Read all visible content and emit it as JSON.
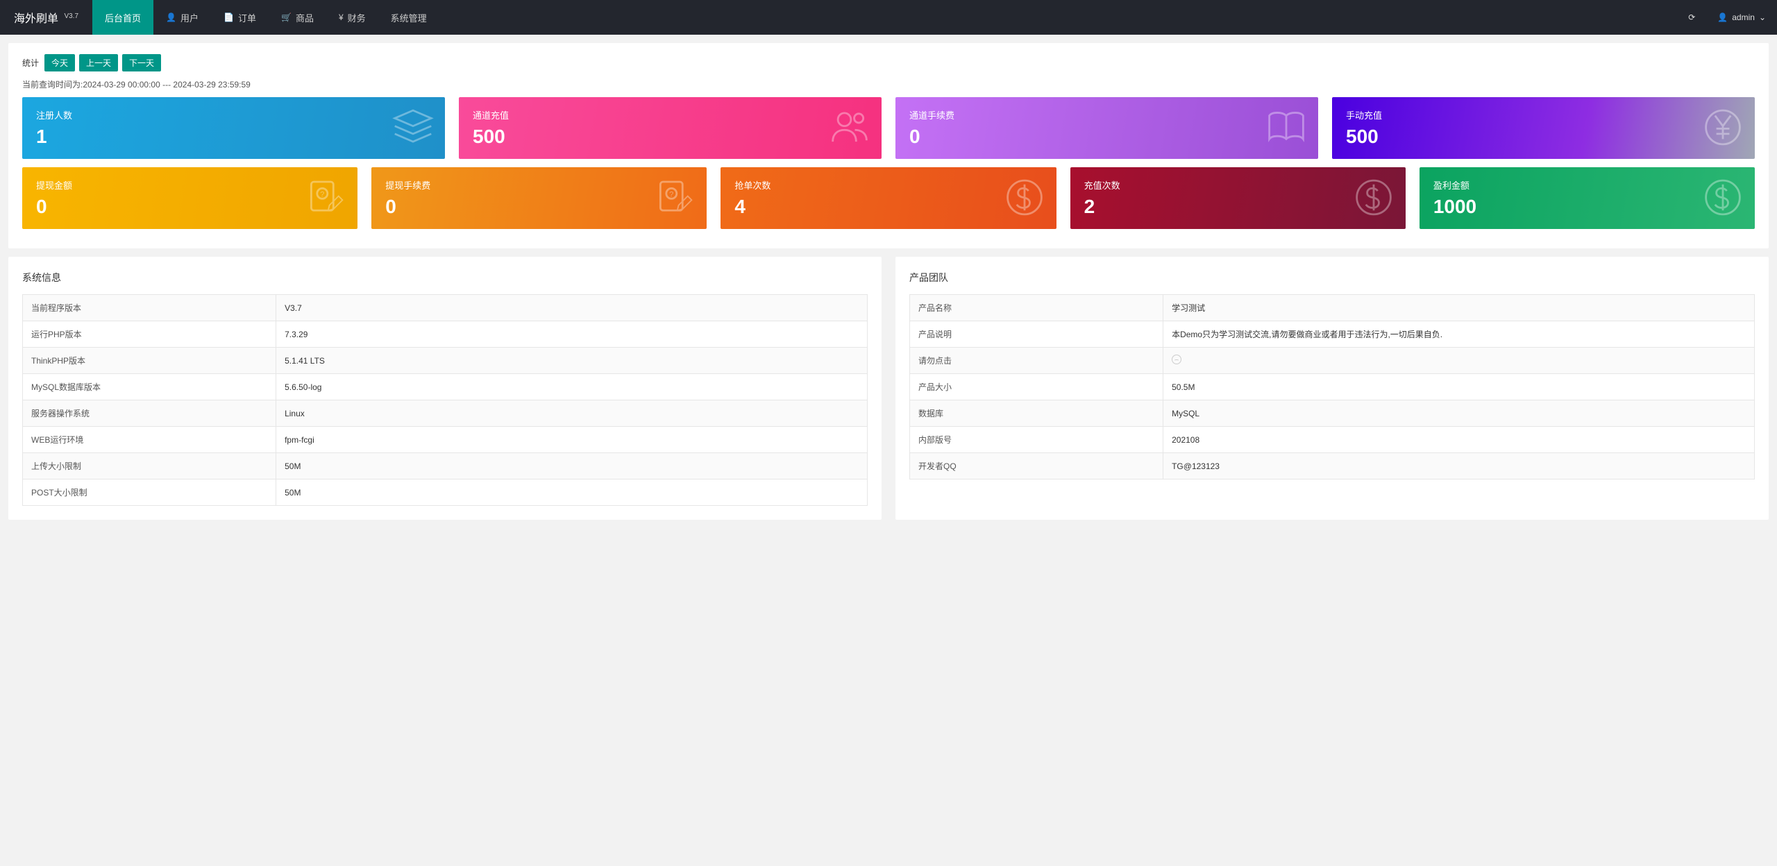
{
  "brand": {
    "name": "海外刷单",
    "version": "V3.7"
  },
  "nav": {
    "items": [
      {
        "label": "后台首页"
      },
      {
        "label": "用户"
      },
      {
        "label": "订单"
      },
      {
        "label": "商品"
      },
      {
        "label": "财务"
      },
      {
        "label": "系统管理"
      }
    ],
    "user": "admin"
  },
  "stats": {
    "label": "统计",
    "buttons": {
      "today": "今天",
      "prev": "上一天",
      "next": "下一天"
    },
    "query_time": "当前查询时间为:2024-03-29 00:00:00 --- 2024-03-29 23:59:59"
  },
  "cards_row1": [
    {
      "title": "注册人数",
      "value": "1"
    },
    {
      "title": "通道充值",
      "value": "500"
    },
    {
      "title": "通道手续费",
      "value": "0"
    },
    {
      "title": "手动充值",
      "value": "500"
    }
  ],
  "cards_row2": [
    {
      "title": "提现金额",
      "value": "0"
    },
    {
      "title": "提现手续费",
      "value": "0"
    },
    {
      "title": "抢单次数",
      "value": "4"
    },
    {
      "title": "充值次数",
      "value": "2"
    },
    {
      "title": "盈利金额",
      "value": "1000"
    }
  ],
  "sysinfo": {
    "title": "系统信息",
    "rows": [
      {
        "k": "当前程序版本",
        "v": "V3.7"
      },
      {
        "k": "运行PHP版本",
        "v": "7.3.29"
      },
      {
        "k": "ThinkPHP版本",
        "v": "5.1.41 LTS"
      },
      {
        "k": "MySQL数据库版本",
        "v": "5.6.50-log"
      },
      {
        "k": "服务器操作系统",
        "v": "Linux"
      },
      {
        "k": "WEB运行环境",
        "v": "fpm-fcgi"
      },
      {
        "k": "上传大小限制",
        "v": "50M"
      },
      {
        "k": "POST大小限制",
        "v": "50M"
      }
    ]
  },
  "team": {
    "title": "产品团队",
    "rows": [
      {
        "k": "产品名称",
        "v": "学习测试"
      },
      {
        "k": "产品说明",
        "v": "本Demo只为学习测试交流,请勿要做商业或者用于违法行为,一切后果自负."
      },
      {
        "k": "请勿点击",
        "v": ""
      },
      {
        "k": "产品大小",
        "v": "50.5M"
      },
      {
        "k": "数据库",
        "v": "MySQL"
      },
      {
        "k": "内部版号",
        "v": "202108"
      },
      {
        "k": "开发者QQ",
        "v": "TG@123123"
      }
    ]
  }
}
